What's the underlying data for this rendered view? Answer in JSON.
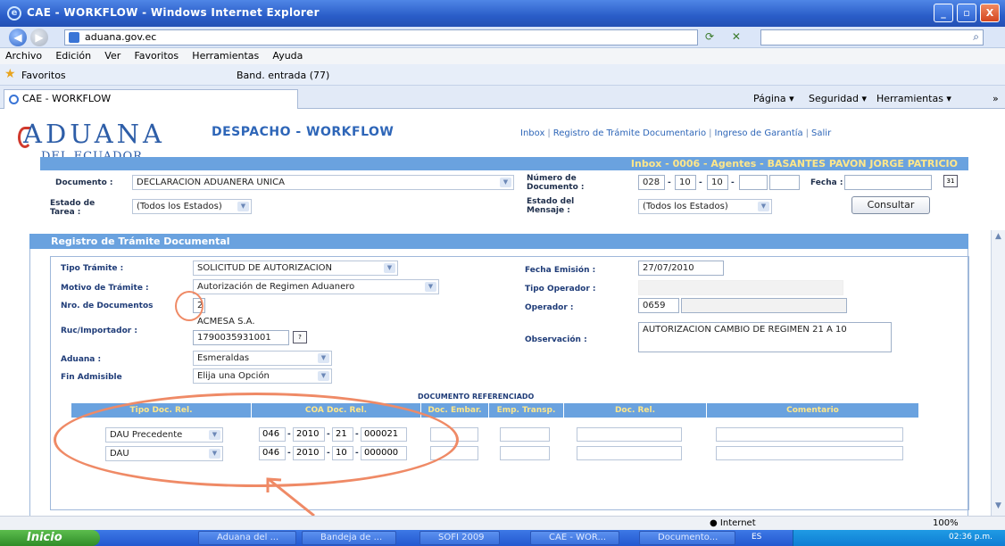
{
  "window": {
    "title": "CAE - WORKFLOW - Windows Internet Explorer",
    "ie_glyph": "e",
    "min_glyph": "_",
    "max_glyph": "▫",
    "close_glyph": "X"
  },
  "browser": {
    "back_glyph": "◀",
    "forward_glyph": "▶",
    "address": "aduana.gov.ec",
    "address_icons": "⟳ ✕",
    "search_glyph": "⌕",
    "menu": [
      "Archivo",
      "Edición",
      "Ver",
      "Favoritos",
      "Herramientas",
      "Ayuda"
    ],
    "favorites_label": "Favoritos",
    "favorites_link": "Band. entrada (77)",
    "tab_label": "CAE - WORKFLOW",
    "commands": [
      "Página ▾",
      "Seguridad ▾",
      "Herramientas ▾",
      "»"
    ]
  },
  "header": {
    "logo_main": "ADUANA",
    "logo_sub": "DEL ECUADOR",
    "app_title": "DESPACHO - WORKFLOW",
    "links": [
      "Inbox",
      "Registro de Trámite Documentario",
      "Ingreso de Garantía",
      "Salir"
    ],
    "link_separator": "|",
    "inbox_bar": "Inbox - 0006 - Agentes - BASANTES PAVON JORGE PATRICIO"
  },
  "filters": {
    "documento_label": "Documento :",
    "documento_value": "DECLARACION ADUANERA UNICA",
    "numero_label_1": "Número de",
    "numero_label_2": "Documento :",
    "numero_parts": [
      "028",
      "10",
      "10",
      ""
    ],
    "dash": "-",
    "fecha_label": "Fecha :",
    "calendar_glyph": "31",
    "estado_tarea_label_1": "Estado de",
    "estado_tarea_label_2": "Tarea :",
    "estado_tarea_value": "(Todos los Estados)",
    "estado_mensaje_label_1": "Estado del",
    "estado_mensaje_label_2": "Mensaje :",
    "estado_mensaje_value": "(Todos los Estados)",
    "consultar_label": "Consultar"
  },
  "registro": {
    "title": "Registro de Trámite Documental",
    "tipo_tramite_label": "Tipo Trámite :",
    "tipo_tramite_value": "SOLICITUD DE AUTORIZACION",
    "motivo_label": "Motivo de Trámite :",
    "motivo_value": "Autorización de Regimen Aduanero",
    "nro_docs_label": "Nro. de Documentos",
    "nro_docs_value": "2",
    "ruc_label": "Ruc/Importador :",
    "ruc_name": "ACMESA S.A.",
    "ruc_number": "1790035931001",
    "help_glyph": "?",
    "aduana_label": "Aduana :",
    "aduana_value": "Esmeraldas",
    "fin_label": "Fin Admisible",
    "fin_value": "Elija una Opción",
    "fecha_emision_label": "Fecha Emisión :",
    "fecha_emision_value": "27/07/2010",
    "tipo_operador_label": "Tipo Operador :",
    "operador_label": "Operador :",
    "operador_value": "0659",
    "observacion_label": "Observación :",
    "observacion_value": "AUTORIZACION CAMBIO DE REGIMEN 21 A 10"
  },
  "docref": {
    "title": "DOCUMENTO REFERENCIADO",
    "columns": [
      "Tipo Doc. Rel.",
      "COA Doc. Rel.",
      "Doc. Embar.",
      "Emp. Transp.",
      "Doc. Rel.",
      "Comentario"
    ],
    "rows": [
      {
        "tipo": "DAU Precedente",
        "coa": [
          "046",
          "2010",
          "21",
          "000021"
        ]
      },
      {
        "tipo": "DAU",
        "coa": [
          "046",
          "2010",
          "10",
          "000000"
        ]
      }
    ]
  },
  "status": {
    "zone": "Internet",
    "zoom": "100%"
  },
  "taskbar": {
    "start": "Inicio",
    "items": [
      "Aduana del ...",
      "Bandeja de ...",
      "SOFI 2009",
      "CAE - WOR...",
      "Documento..."
    ],
    "lang": "ES",
    "clock": "02:36 p.m."
  },
  "icons": {
    "dropdown": "chevron-down-icon",
    "calendar": "calendar-icon",
    "help": "help-icon",
    "favorites": "star-icon"
  },
  "colors": {
    "header_bar": "#6aa2df",
    "header_text": "#ffe78a",
    "annotation": "#ef8a66",
    "brand": "#2e5ea8"
  }
}
